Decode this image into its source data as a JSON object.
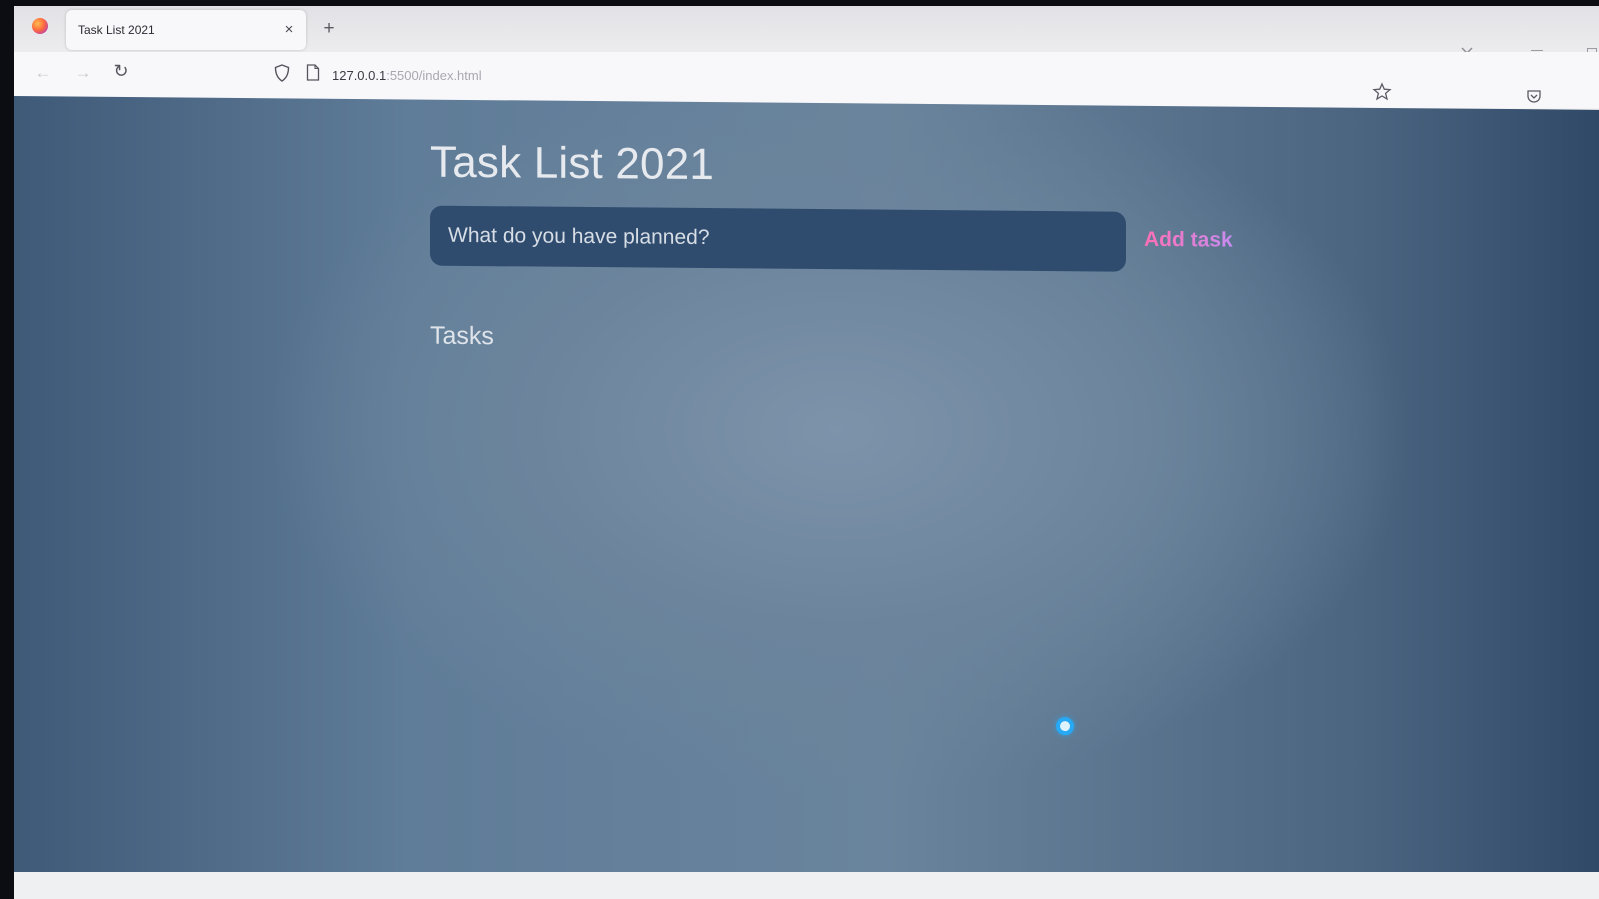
{
  "browser": {
    "tab": {
      "title": "Task List 2021",
      "close_glyph": "×"
    },
    "new_tab_glyph": "+",
    "nav": {
      "back_glyph": "←",
      "forward_glyph": "→",
      "reload_glyph": "↻"
    },
    "url": {
      "host": "127.0.0.1",
      "path": ":5500/index.html"
    }
  },
  "app": {
    "title": "Task List 2021",
    "input_placeholder": "What do you have planned?",
    "add_button_label": "Add task",
    "tasks_heading": "Tasks",
    "tasks": []
  },
  "colors": {
    "accent_pink": "#ff6fb5",
    "accent_violet": "#c88cf0",
    "input_background": "#2f4c6f",
    "background_blue": "#5f7c98",
    "cursor_blue": "#27a9f5"
  },
  "icons": [
    "firefox-logo-icon",
    "close-icon",
    "plus-icon",
    "chevron-down-icon",
    "minimize-icon",
    "restore-icon",
    "back-arrow-icon",
    "forward-arrow-icon",
    "reload-icon",
    "shield-icon",
    "page-icon",
    "star-icon",
    "pocket-icon",
    "busy-cursor-icon"
  ]
}
